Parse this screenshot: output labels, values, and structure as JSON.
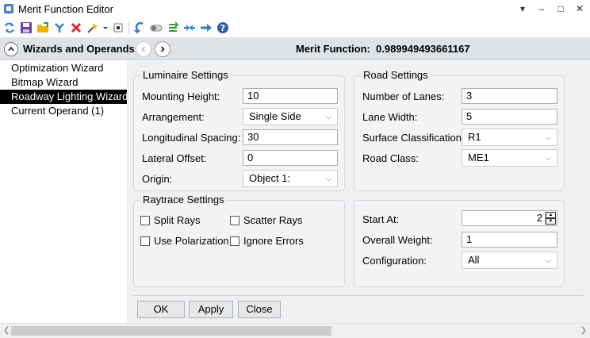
{
  "window": {
    "title": "Merit Function Editor",
    "controls": [
      "▾",
      "–",
      "□",
      "✕"
    ]
  },
  "toolbar": {
    "icons": [
      "refresh-icon",
      "save-icon",
      "open-icon",
      "insert-icon",
      "delete-icon",
      "wizard-icon",
      "dropdown-arrow-icon",
      "small-square-icon",
      "undo-icon",
      "toggle-icon",
      "sort-icon",
      "collapse-icon",
      "arrow-right-icon",
      "help-icon"
    ]
  },
  "header": {
    "title": "Wizards and Operands",
    "merit_label": "Merit Function:",
    "merit_value": "0.989949493661167"
  },
  "sidebar": {
    "items": [
      {
        "label": "Optimization Wizard",
        "selected": false
      },
      {
        "label": "Bitmap Wizard",
        "selected": false
      },
      {
        "label": "Roadway Lighting Wizard",
        "selected": true
      },
      {
        "label": "Current Operand (1)",
        "selected": false
      }
    ]
  },
  "luminaire": {
    "title": "Luminaire Settings",
    "mounting_height_label": "Mounting Height:",
    "mounting_height_value": "10",
    "arrangement_label": "Arrangement:",
    "arrangement_value": "Single Side",
    "long_spacing_label": "Longitudinal Spacing:",
    "long_spacing_value": "30",
    "lateral_offset_label": "Lateral Offset:",
    "lateral_offset_value": "0",
    "origin_label": "Origin:",
    "origin_value": "Object 1:"
  },
  "road": {
    "title": "Road Settings",
    "lanes_label": "Number of Lanes:",
    "lanes_value": "3",
    "lane_width_label": "Lane Width:",
    "lane_width_value": "5",
    "surface_label": "Surface Classification :",
    "surface_value": "R1",
    "road_class_label": "Road Class:",
    "road_class_value": "ME1"
  },
  "raytrace": {
    "title": "Raytrace Settings",
    "split_rays": "Split Rays",
    "scatter_rays": "Scatter Rays",
    "use_polarization": "Use Polarization",
    "ignore_errors": "Ignore Errors"
  },
  "weights": {
    "start_at_label": "Start At:",
    "start_at_value": "2",
    "overall_weight_label": "Overall Weight:",
    "overall_weight_value": "1",
    "configuration_label": "Configuration:",
    "configuration_value": "All"
  },
  "buttons": {
    "ok": "OK",
    "apply": "Apply",
    "close": "Close"
  }
}
